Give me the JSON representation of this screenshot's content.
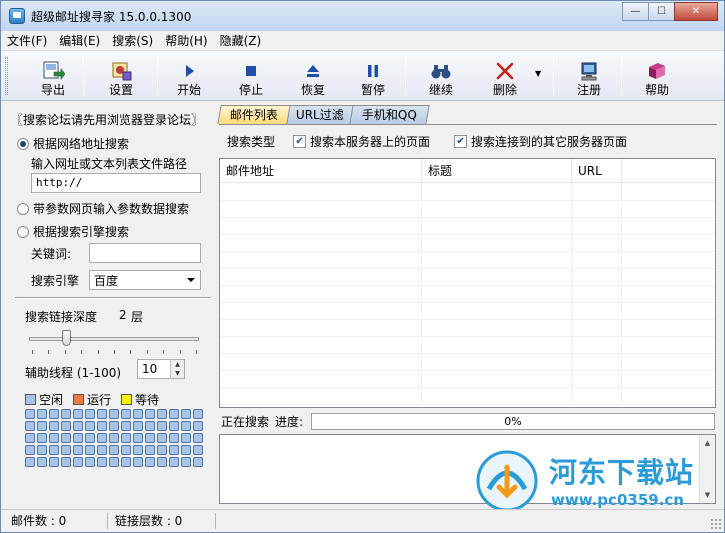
{
  "window": {
    "title": "超级邮址搜寻家 15.0.0.1300",
    "controls": {
      "minimize": "—",
      "maximize": "☐",
      "close": "✕"
    }
  },
  "menu": [
    "文件(F)",
    "编辑(E)",
    "搜索(S)",
    "帮助(H)",
    "隐藏(Z)"
  ],
  "toolbar": {
    "export": "导出",
    "settings": "设置",
    "start": "开始",
    "stop": "停止",
    "resume": "恢复",
    "pause": "暂停",
    "continue": "继续",
    "delete": "删除",
    "register": "注册",
    "help": "帮助",
    "dropdown_arrow": "▼"
  },
  "left": {
    "notice": "〖搜索论坛请先用浏览器登录论坛〗",
    "mode_url": "根据网络地址搜索",
    "url_hint": "输入网址或文本列表文件路径",
    "url_value": "http://",
    "mode_param": "带参数网页输入参数数据搜索",
    "mode_engine": "根据搜索引擎搜索",
    "keyword_label": "关键词:",
    "keyword_value": "",
    "engine_label": "搜索引擎",
    "engine_value": "百度",
    "depth_label": "搜索链接深度",
    "depth_value": "2",
    "depth_unit": "层",
    "threads_label": "辅助线程 (1-100)",
    "threads_value": "10",
    "legend_idle": "空闲",
    "legend_run": "运行",
    "legend_wait": "等待",
    "colors": {
      "idle": "#a8c4e8",
      "run": "#f07a3c",
      "wait": "#f5f000"
    }
  },
  "right": {
    "tabs": [
      "邮件列表",
      "URL过滤",
      "手机和QQ"
    ],
    "search_type_label": "搜索类型",
    "opt_same_server": "搜索本服务器上的页面",
    "opt_other_server": "搜索连接到的其它服务器页面",
    "columns": [
      "邮件地址",
      "标题",
      "URL"
    ],
    "searching_label": "正在搜索",
    "progress_label": "进度:",
    "progress_text": "0%"
  },
  "watermark": {
    "name": "河东下载站",
    "url": "www.pc0359.cn"
  },
  "statusbar": {
    "mail_count": "邮件数 : 0",
    "link_depth": "链接层数 : 0"
  }
}
